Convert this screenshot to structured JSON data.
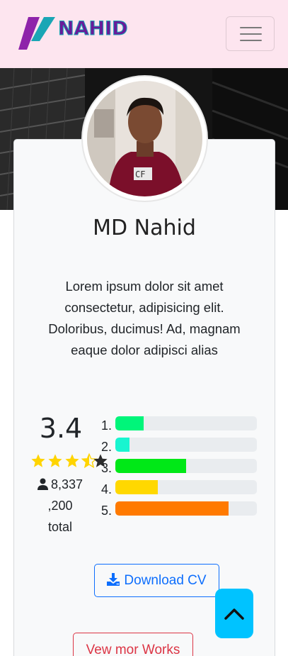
{
  "navbar": {
    "brand": "NAHID",
    "logo_colors": {
      "purple": "#8e24aa",
      "teal": "#1aa6b5"
    }
  },
  "profile": {
    "name": "MD Nahid",
    "bio": "Lorem ipsum dolor sit amet consectetur, adipisicing elit. Doloribus, ducimus! Ad, magnam eaque dolor adipisci alias"
  },
  "rating": {
    "score": "3.4",
    "stars_out_of_5": 4.5,
    "users_count": "8,337",
    "total_text_line1": ",200",
    "total_text_line2": "total",
    "rows": [
      {
        "label": "1.",
        "fill_fraction": 0.2,
        "color": "#00f57a"
      },
      {
        "label": "2.",
        "fill_fraction": 0.1,
        "color": "#18f5d0"
      },
      {
        "label": "3.",
        "fill_fraction": 0.5,
        "color": "#00e817"
      },
      {
        "label": "4.",
        "fill_fraction": 0.3,
        "color": "#ffd800"
      },
      {
        "label": "5.",
        "fill_fraction": 0.8,
        "color": "#ff7a00"
      }
    ]
  },
  "actions": {
    "download_label": "Download CV",
    "works_label": "Vew mor Works"
  },
  "colors": {
    "navbar_bg": "#fde5ef",
    "primary": "#0d6efd",
    "danger": "#dc3545",
    "scroll_top_bg": "#00c3ff",
    "star": "#ffd400"
  },
  "icons": {
    "menu": "hamburger-icon",
    "user": "user-icon",
    "download": "download-icon",
    "scroll_top": "chevron-up-icon"
  }
}
